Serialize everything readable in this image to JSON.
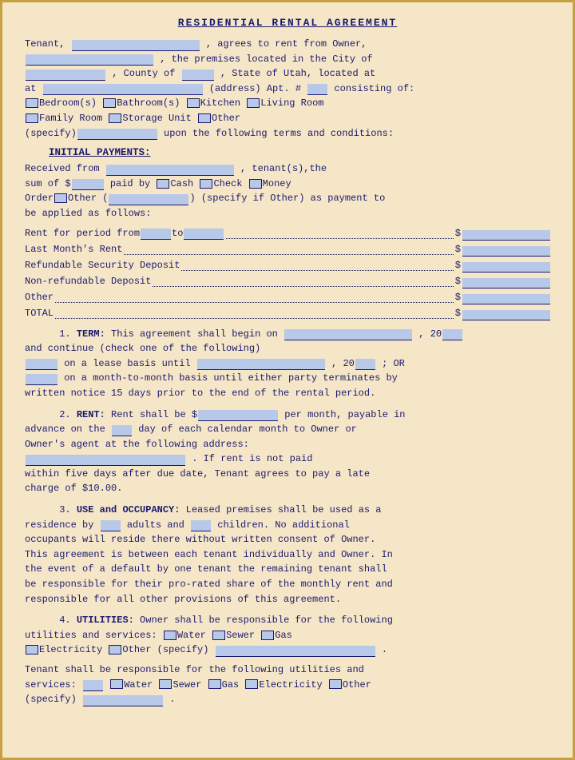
{
  "title": "RESIDENTIAL RENTAL AGREEMENT",
  "sections": {
    "intro": {
      "tenant_label": "Tenant,",
      "agrees": ", agrees to rent from Owner,",
      "premises": ", the premises located in the City of",
      "county": ", County of",
      "state": ", State of Utah, located at",
      "address_label": "(address) Apt. #",
      "consisting": "consisting of:",
      "rooms": [
        "Bedroom(s)",
        "Bathroom(s)",
        "Kitchen",
        "Living Room",
        "Family Room",
        "Storage Unit",
        "Other"
      ],
      "specify_label": "(specify)",
      "upon": "upon the following terms and conditions:"
    },
    "initial_payments": {
      "title": "INITIAL PAYMENTS:",
      "received_from": "Received from",
      "tenant_s_the": ", tenant(s),the",
      "sum_of": "sum of $",
      "paid_by": "paid by",
      "payment_types": [
        "Cash",
        "Check",
        "Money"
      ],
      "order": "Order",
      "other": "Other (",
      "specify_other": ") (specify if Other) as payment to",
      "be_applied": "be applied as follows:"
    },
    "payment_lines": [
      {
        "label": "Rent for period from",
        "mid": "to",
        "dots": true
      },
      {
        "label": "Last Month's Rent",
        "dots": true
      },
      {
        "label": "Refundable Security Deposit",
        "dots": true
      },
      {
        "label": "Non-refundable Deposit",
        "dots": true
      },
      {
        "label": "Other",
        "dots": true
      },
      {
        "label": "TOTAL",
        "dots": true
      }
    ],
    "term": {
      "number": "1.",
      "title": "TERM:",
      "text1": "This agreement shall begin on",
      "text2": ", 20",
      "text3": "and continue (check one of the following)",
      "text4": "on a lease basis until",
      "text5": ", 20",
      "text6": "; OR",
      "text7": "on a month-to-month basis until either party terminates by",
      "text8": "written notice 15 days prior to the end of the rental period."
    },
    "rent": {
      "number": "2.",
      "title": "RENT:",
      "text1": "Rent shall be $",
      "text2": "per month, payable in",
      "text3": "advance on the",
      "text4": "day of each calendar month to Owner or",
      "text5": "Owner's agent at the following address:",
      "text6": ". If rent is not paid",
      "text7": "within five days after due date, Tenant agrees to pay a late",
      "text8": "charge of $10.00."
    },
    "occupancy": {
      "number": "3.",
      "title": "USE and OCCUPANCY:",
      "text1": "Leased premises shall be used as a",
      "text2": "residence by",
      "text3": "adults and",
      "text4": "children. No additional",
      "text5": "occupants will reside there without written consent of Owner.",
      "text6": "This agreement is between each tenant individually and Owner.  In",
      "text7": "the event of a default by one tenant the remaining tenant shall",
      "text8": "be responsible for their pro-rated share of the monthly rent and",
      "text9": "responsible for all other provisions of this agreement."
    },
    "utilities": {
      "number": "4.",
      "title": "UTILITIES:",
      "text1": "Owner shall be responsible for the following",
      "text2": "utilities and services:",
      "items": [
        "Water",
        "Sewer",
        "Gas",
        "Electricity",
        "Other (specify)"
      ],
      "text3": "Tenant shall be responsible for the following utilities and",
      "text4": "services:",
      "tenant_items": [
        "Water",
        "Sewer",
        "Gas",
        "Electricity",
        "Other"
      ],
      "specify_label": "(specify)"
    }
  }
}
